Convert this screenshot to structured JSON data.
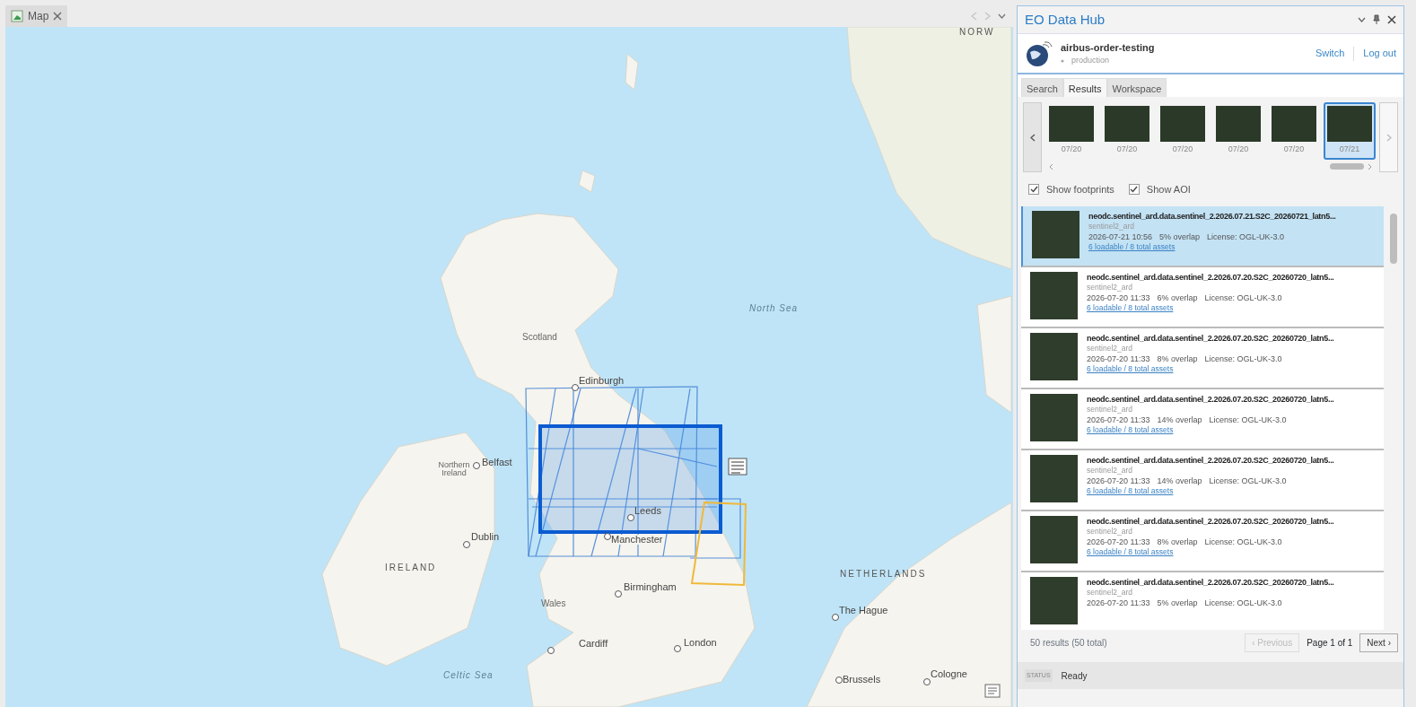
{
  "map_tab": {
    "label": "Map"
  },
  "map": {
    "labels": [
      {
        "text": "NORW",
        "kind": "country"
      },
      {
        "text": "Scotland",
        "kind": "region"
      },
      {
        "text": "North Sea",
        "kind": "sea"
      },
      {
        "text": "Edinburgh",
        "kind": "city"
      },
      {
        "text": "Northern Ireland",
        "kind": "region"
      },
      {
        "text": "Belfast",
        "kind": "city"
      },
      {
        "text": "Dublin",
        "kind": "city"
      },
      {
        "text": "IRELAND",
        "kind": "country"
      },
      {
        "text": "Leeds",
        "kind": "city"
      },
      {
        "text": "Manchester",
        "kind": "city"
      },
      {
        "text": "Birmingham",
        "kind": "city"
      },
      {
        "text": "Wales",
        "kind": "region"
      },
      {
        "text": "Cardiff",
        "kind": "city"
      },
      {
        "text": "London",
        "kind": "city"
      },
      {
        "text": "NETHERLANDS",
        "kind": "country"
      },
      {
        "text": "The Hague",
        "kind": "city"
      },
      {
        "text": "Celtic Sea",
        "kind": "sea"
      },
      {
        "text": "Brussels",
        "kind": "city"
      },
      {
        "text": "Cologne",
        "kind": "city"
      }
    ]
  },
  "panel": {
    "title": "EO Data Hub",
    "account": {
      "name": "airbus-order-testing",
      "environment": "production",
      "actions": [
        "Switch",
        "Log out"
      ]
    },
    "tabs": [
      {
        "label": "Search",
        "selected": false
      },
      {
        "label": "Results",
        "selected": true
      },
      {
        "label": "Workspace",
        "selected": false
      }
    ],
    "thumbnails": [
      {
        "date": "07/20",
        "selected": false
      },
      {
        "date": "07/20",
        "selected": false
      },
      {
        "date": "07/20",
        "selected": false
      },
      {
        "date": "07/20",
        "selected": false
      },
      {
        "date": "07/20",
        "selected": false
      },
      {
        "date": "07/21",
        "selected": true
      }
    ],
    "options": [
      {
        "label": "Show footprints",
        "checked": true
      },
      {
        "label": "Show AOI",
        "checked": true
      }
    ],
    "results": [
      {
        "title": "neodc.sentinel_ard.data.sentinel_2.2026.07.21.S2C_20260721_latn5...",
        "collection": "sentinel2_ard",
        "datetime": "2026-07-21 10:56",
        "overlap": "5% overlap",
        "license": "License: OGL-UK-3.0",
        "assets": "6 loadable / 8 total assets",
        "selected": true
      },
      {
        "title": "neodc.sentinel_ard.data.sentinel_2.2026.07.20.S2C_20260720_latn5...",
        "collection": "sentinel2_ard",
        "datetime": "2026-07-20 11:33",
        "overlap": "6% overlap",
        "license": "License: OGL-UK-3.0",
        "assets": "6 loadable / 8 total assets",
        "selected": false
      },
      {
        "title": "neodc.sentinel_ard.data.sentinel_2.2026.07.20.S2C_20260720_latn5...",
        "collection": "sentinel2_ard",
        "datetime": "2026-07-20 11:33",
        "overlap": "8% overlap",
        "license": "License: OGL-UK-3.0",
        "assets": "6 loadable / 8 total assets",
        "selected": false
      },
      {
        "title": "neodc.sentinel_ard.data.sentinel_2.2026.07.20.S2C_20260720_latn5...",
        "collection": "sentinel2_ard",
        "datetime": "2026-07-20 11:33",
        "overlap": "14% overlap",
        "license": "License: OGL-UK-3.0",
        "assets": "6 loadable / 8 total assets",
        "selected": false
      },
      {
        "title": "neodc.sentinel_ard.data.sentinel_2.2026.07.20.S2C_20260720_latn5...",
        "collection": "sentinel2_ard",
        "datetime": "2026-07-20 11:33",
        "overlap": "14% overlap",
        "license": "License: OGL-UK-3.0",
        "assets": "6 loadable / 8 total assets",
        "selected": false
      },
      {
        "title": "neodc.sentinel_ard.data.sentinel_2.2026.07.20.S2C_20260720_latn5...",
        "collection": "sentinel2_ard",
        "datetime": "2026-07-20 11:33",
        "overlap": "8% overlap",
        "license": "License: OGL-UK-3.0",
        "assets": "6 loadable / 8 total assets",
        "selected": false
      },
      {
        "title": "neodc.sentinel_ard.data.sentinel_2.2026.07.20.S2C_20260720_latn5...",
        "collection": "sentinel2_ard",
        "datetime": "2026-07-20 11:33",
        "overlap": "5% overlap",
        "license": "License: OGL-UK-3.0",
        "selected": false
      }
    ],
    "pager": {
      "summary": "50 results (50 total)",
      "previous": {
        "label": "‹ Previous",
        "disabled": true
      },
      "page": "Page 1 of 1",
      "next": {
        "label": "Next ›",
        "disabled": false
      }
    },
    "status": {
      "label": "STATUS",
      "value": "Ready"
    }
  }
}
